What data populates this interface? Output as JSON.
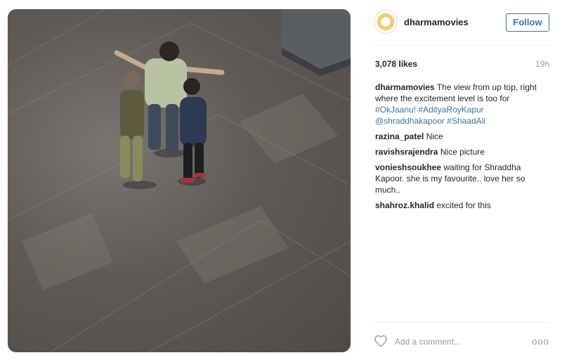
{
  "post": {
    "username": "dharmamovies",
    "follow_label": "Follow",
    "likes": "3,078 likes",
    "time": "19h"
  },
  "caption": {
    "user": "dharmamovies",
    "text": "The view from up top, right where the excitement level is too for",
    "tags": [
      "#OkJaanu!",
      "#AdityaRoyKapur",
      "@shraddhakapoor",
      "#ShaadAli"
    ]
  },
  "comments": [
    {
      "user": "razina_patel",
      "text": "Nice"
    },
    {
      "user": "ravishsrajendra",
      "text": "Nice picture"
    },
    {
      "user": "vonieshsoukhee",
      "text": "waiting for Shraddha Kapoor. she is my favourite.. love her so much.."
    },
    {
      "user": "shahroz.khalid",
      "text": "excited for this"
    }
  ],
  "composer": {
    "placeholder": "Add a comment...",
    "more_label": "ooo"
  },
  "icons": {
    "like": "heart-icon",
    "options": "more-options-icon",
    "avatar": "dharma-logo"
  },
  "colors": {
    "link": "#3f729b",
    "secondary": "#999999"
  }
}
